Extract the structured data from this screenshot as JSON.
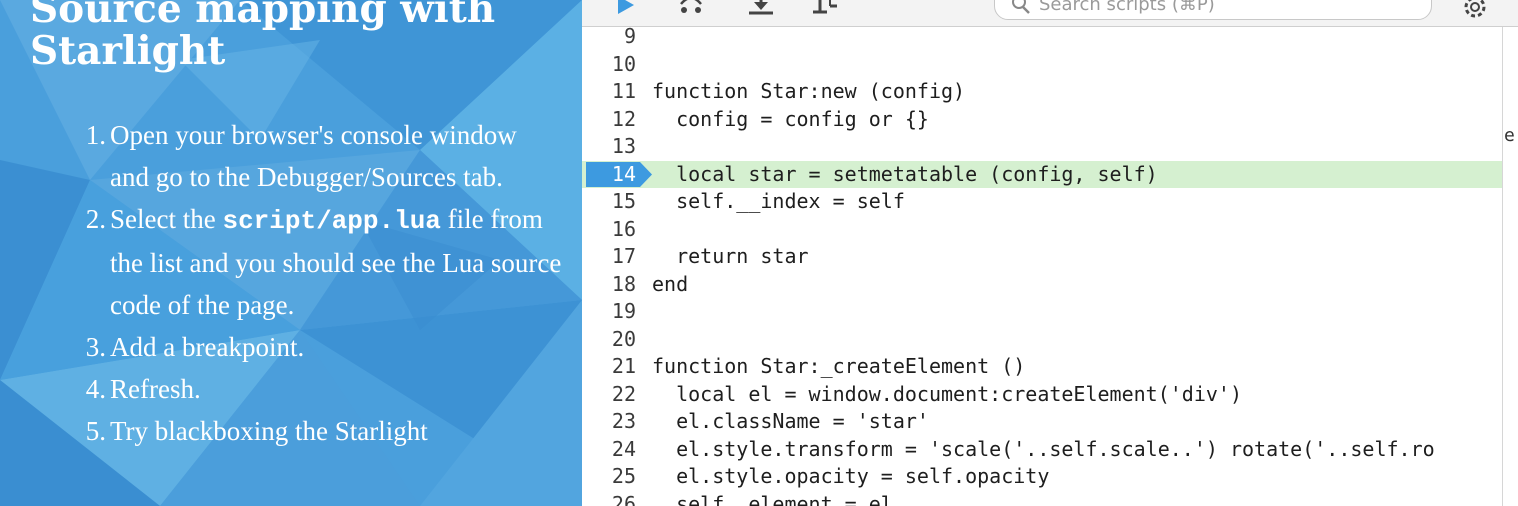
{
  "slide": {
    "title_line1": "Source mapping with",
    "title_line2": "Starlight",
    "steps": [
      {
        "num": "1.",
        "parts": [
          "Open your browser's console window and go to the Debugger/Sources tab."
        ]
      },
      {
        "num": "2.",
        "before": "Select the ",
        "code": "script/app.lua",
        "after": " file from the list and you should see the Lua source code of the page."
      },
      {
        "num": "3.",
        "parts": [
          "Add a breakpoint."
        ]
      },
      {
        "num": "4.",
        "parts": [
          "Refresh."
        ]
      },
      {
        "num": "5.",
        "parts": [
          "Try blackboxing the Starlight"
        ]
      }
    ]
  },
  "devtools": {
    "search": {
      "placeholder": "Search scripts (⌘P)"
    },
    "right_strip_glyph": "e",
    "active_line": 14,
    "lines": [
      {
        "n": "9",
        "code": ""
      },
      {
        "n": "10",
        "code": ""
      },
      {
        "n": "11",
        "code": "function Star:new (config)"
      },
      {
        "n": "12",
        "code": "  config = config or {}"
      },
      {
        "n": "13",
        "code": ""
      },
      {
        "n": "14",
        "code": "  local star = setmetatable (config, self)"
      },
      {
        "n": "15",
        "code": "  self.__index = self"
      },
      {
        "n": "16",
        "code": ""
      },
      {
        "n": "17",
        "code": "  return star"
      },
      {
        "n": "18",
        "code": "end"
      },
      {
        "n": "19",
        "code": ""
      },
      {
        "n": "20",
        "code": ""
      },
      {
        "n": "21",
        "code": "function Star:_createElement ()"
      },
      {
        "n": "22",
        "code": "  local el = window.document:createElement('div')"
      },
      {
        "n": "23",
        "code": "  el.className = 'star'"
      },
      {
        "n": "24",
        "code": "  el.style.transform = 'scale('..self.scale..') rotate('..self.ro"
      },
      {
        "n": "25",
        "code": "  el.style.opacity = self.opacity"
      },
      {
        "n": "26",
        "code": "  self._element = el"
      }
    ]
  },
  "colors": {
    "slide_bg": "#4a9fdc",
    "active_line_bg": "#d5f0d0",
    "breakpoint_marker": "#3d9ae0"
  }
}
